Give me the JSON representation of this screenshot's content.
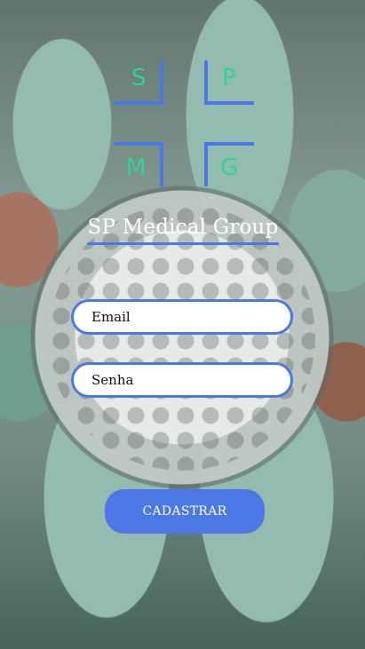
{
  "logo": {
    "letters": [
      "S",
      "P",
      "M",
      "G"
    ],
    "accent_color": "#4b78e5",
    "letter_color": "#2fd39b"
  },
  "title": "SP Medical Group",
  "form": {
    "email_placeholder": "Email",
    "password_placeholder": "Senha",
    "submit_label": "CADASTRAR"
  },
  "background": {
    "description_icon": "surgeons-photo"
  }
}
